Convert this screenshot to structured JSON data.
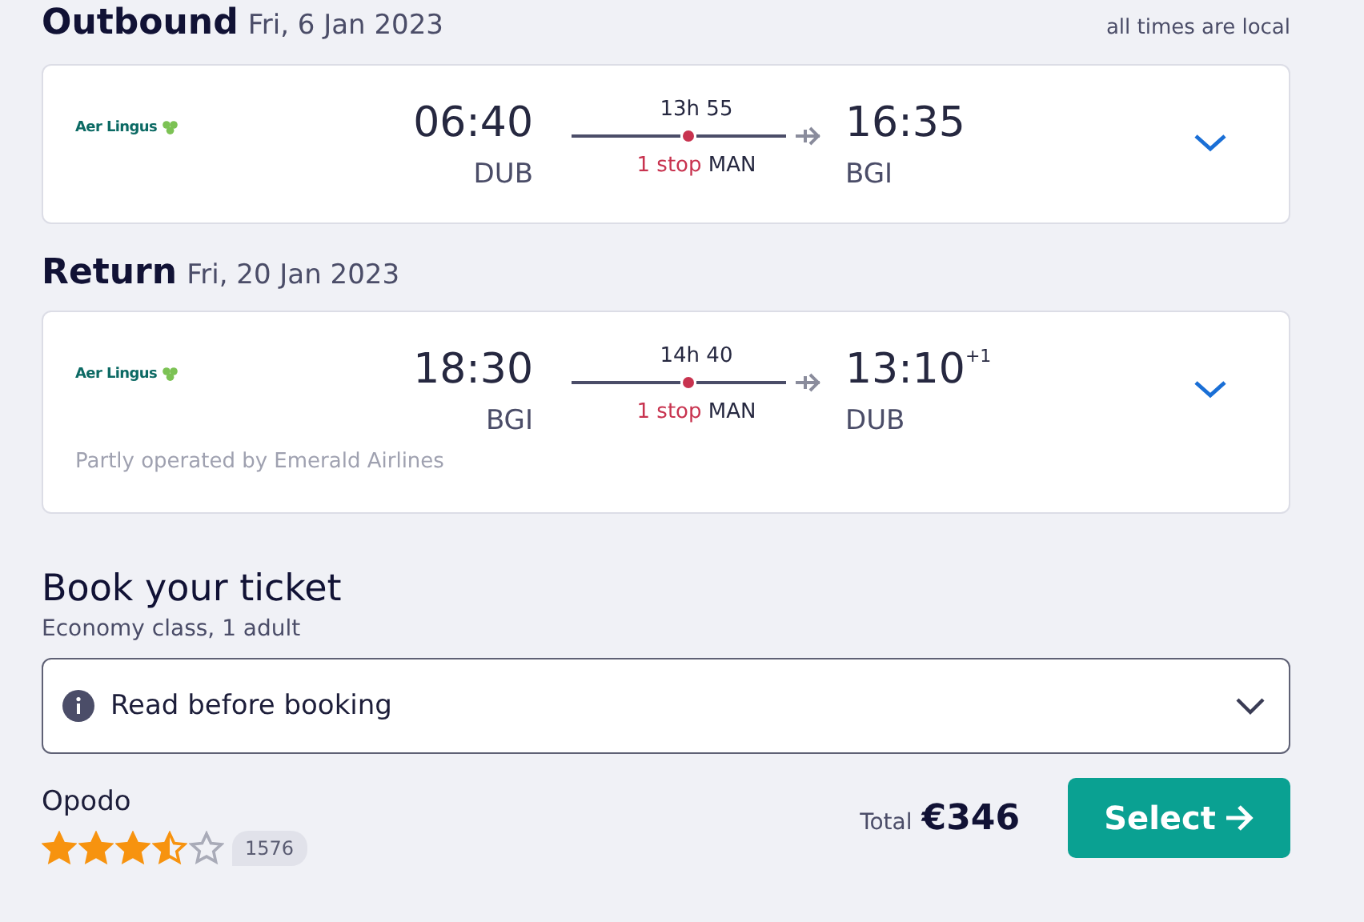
{
  "legs": [
    {
      "title": "Outbound",
      "date": "Fri, 6 Jan 2023",
      "side_note": "all times are local",
      "airline": "Aer Lingus",
      "depart_time": "06:40",
      "depart_airport": "DUB",
      "duration": "13h 55",
      "stops": "1 stop",
      "stop_airport": "MAN",
      "arrive_time": "16:35",
      "arrive_airport": "BGI"
    },
    {
      "title": "Return",
      "date": "Fri, 20 Jan 2023",
      "airline": "Aer Lingus",
      "depart_time": "18:30",
      "depart_airport": "BGI",
      "duration": "14h 40",
      "stops": "1 stop",
      "stop_airport": "MAN",
      "arrive_time": "13:10",
      "arrive_day_offset": "+1",
      "arrive_airport": "DUB",
      "operator_note": "Partly operated by Emerald Airlines"
    }
  ],
  "booking": {
    "title": "Book your ticket",
    "subtitle": "Economy class, 1 adult",
    "info": "Read before booking",
    "provider": "Opodo",
    "stars": 3.5,
    "reviews": "1576",
    "total_label": "Total",
    "price": "€346",
    "button": "Select"
  }
}
